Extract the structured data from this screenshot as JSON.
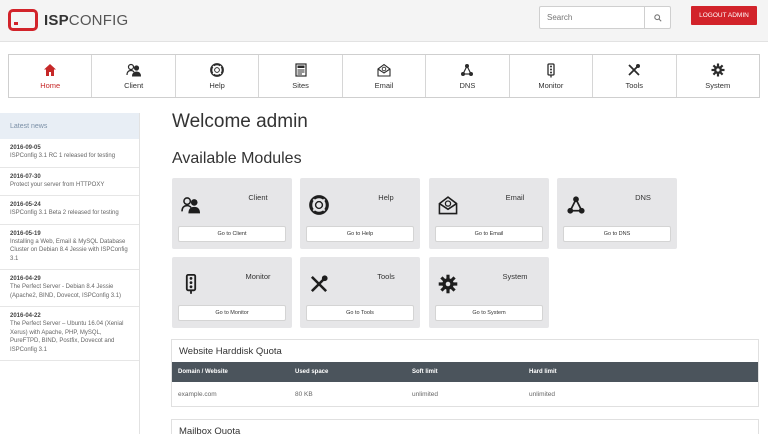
{
  "header": {
    "logo_bold": "ISP",
    "logo_light": "CONFIG",
    "search_placeholder": "Search",
    "logout_label": "LOGOUT ADMIN"
  },
  "nav": {
    "items": [
      {
        "label": "Home",
        "icon": "home-icon",
        "active": true
      },
      {
        "label": "Client",
        "icon": "client-icon"
      },
      {
        "label": "Help",
        "icon": "help-icon"
      },
      {
        "label": "Sites",
        "icon": "sites-icon"
      },
      {
        "label": "Email",
        "icon": "email-icon"
      },
      {
        "label": "DNS",
        "icon": "dns-icon"
      },
      {
        "label": "Monitor",
        "icon": "monitor-icon"
      },
      {
        "label": "Tools",
        "icon": "tools-icon"
      },
      {
        "label": "System",
        "icon": "system-icon"
      }
    ]
  },
  "sidebar": {
    "title": "Latest news",
    "news": [
      {
        "date": "2016-09-05",
        "text": "ISPConfig 3.1 RC 1 released for testing"
      },
      {
        "date": "2016-07-30",
        "text": "Protect your server from HTTPOXY"
      },
      {
        "date": "2016-05-24",
        "text": "ISPConfig 3.1 Beta 2 released for testing"
      },
      {
        "date": "2016-05-19",
        "text": "Installing a Web, Email & MySQL Database Cluster on Debian 8.4 Jessie with ISPConfig 3.1"
      },
      {
        "date": "2016-04-29",
        "text": "The Perfect Server - Debian 8.4 Jessie (Apache2, BIND, Dovecot, ISPConfig 3.1)"
      },
      {
        "date": "2016-04-22",
        "text": "The Perfect Server – Ubuntu 16.04 (Xenial Xerus) with Apache, PHP, MySQL, PureFTPD, BIND, Postfix, Dovecot and ISPConfig 3.1"
      }
    ]
  },
  "main": {
    "welcome": "Welcome admin",
    "modules_title": "Available Modules",
    "modules": [
      {
        "title": "Client",
        "button": "Go to Client",
        "icon": "client-icon"
      },
      {
        "title": "Help",
        "button": "Go to Help",
        "icon": "help-icon"
      },
      {
        "title": "Email",
        "button": "Go to Email",
        "icon": "email-icon"
      },
      {
        "title": "DNS",
        "button": "Go to DNS",
        "icon": "dns-icon"
      },
      {
        "title": "Monitor",
        "button": "Go to Monitor",
        "icon": "monitor-icon"
      },
      {
        "title": "Tools",
        "button": "Go to Tools",
        "icon": "tools-icon"
      },
      {
        "title": "System",
        "button": "Go to System",
        "icon": "system-icon"
      }
    ]
  },
  "harddisk": {
    "title": "Website Harddisk Quota",
    "columns": [
      "Domain / Website",
      "Used space",
      "Soft limit",
      "Hard limit"
    ],
    "rows": [
      [
        "example.com",
        "80 KB",
        "unlimited",
        "unlimited"
      ]
    ]
  },
  "mailbox": {
    "title": "Mailbox Quota"
  },
  "colors": {
    "accent": "#d2232a",
    "table_header": "#4b545c",
    "card_bg": "#e6e6e8",
    "news_header_bg": "#e8eef5"
  }
}
